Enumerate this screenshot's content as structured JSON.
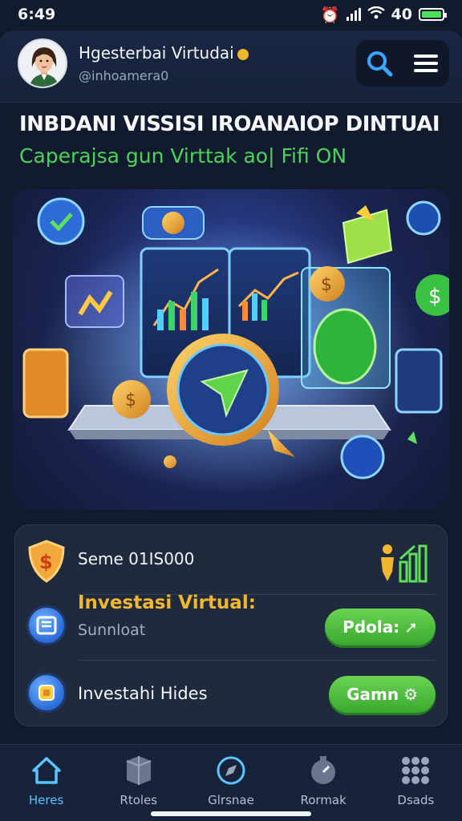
{
  "status": {
    "time": "6:49",
    "battery_text": "40"
  },
  "header": {
    "username": "Hgesterbai Virtudai",
    "handle": "@inhoamera0",
    "icons": [
      "search-icon",
      "menu-icon"
    ]
  },
  "headline": "INBDANI VISSISI IROANAIOP DINTUAI",
  "subheadline": "Caperajsa gun Virttak ao| Fifi ON",
  "panel": {
    "stat_label": "Seme 01IS000",
    "items": [
      {
        "title": "Investasi Virtual:",
        "subtitle": "Sunnloat",
        "button": "Pdola:"
      },
      {
        "title": "Investahi Hides",
        "button": "Gamn"
      }
    ]
  },
  "tabs": [
    {
      "label": "Heres",
      "icon": "home-icon",
      "active": true
    },
    {
      "label": "Rtoles",
      "icon": "box-icon",
      "active": false
    },
    {
      "label": "Glrsnae",
      "icon": "compass-icon",
      "active": false
    },
    {
      "label": "Rormak",
      "icon": "timer-icon",
      "active": false
    },
    {
      "label": "Dsads",
      "icon": "grid-icon",
      "active": false
    }
  ],
  "colors": {
    "accent_green": "#48d45a",
    "accent_gold": "#f2b72e",
    "accent_blue": "#5bc4ff",
    "background": "#121b2e"
  }
}
